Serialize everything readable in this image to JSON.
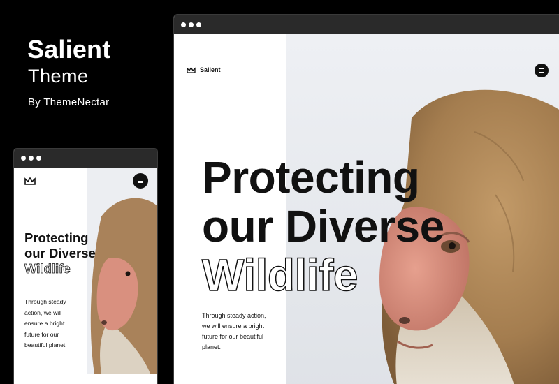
{
  "promo": {
    "title": "Salient",
    "subtitle": "Theme",
    "byline": "By ThemeNectar"
  },
  "desktop_site": {
    "logo_text": "Salient",
    "headline_line1": "Protecting",
    "headline_line2": "our Diverse",
    "headline_outline": "Wildlife",
    "body_lines": [
      "Through steady action,",
      "we will ensure a bright",
      "future for our beautiful",
      "planet."
    ]
  },
  "mobile_site": {
    "headline_line1": "Protecting",
    "headline_line2": "our Diverse",
    "headline_outline": "Wildlife",
    "body_lines": [
      "Through steady",
      "action, we will",
      "ensure a bright",
      "future for our",
      "beautiful planet."
    ]
  },
  "icons": [
    "crown-logo-icon",
    "menu-icon"
  ],
  "colors": {
    "background": "#000000",
    "page": "#ffffff",
    "text": "#111111",
    "fur": "#b08a5a",
    "face": "#d88b7c"
  }
}
